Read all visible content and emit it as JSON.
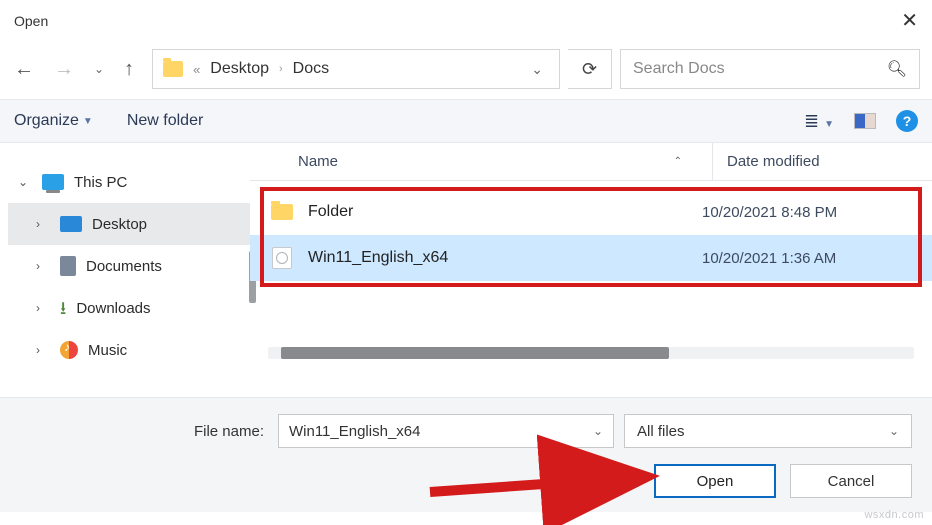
{
  "dialog": {
    "title": "Open"
  },
  "breadcrumb": {
    "root": "Desktop",
    "current": "Docs"
  },
  "search": {
    "placeholder": "Search Docs"
  },
  "toolbar": {
    "organize": "Organize",
    "new_folder": "New folder"
  },
  "sidebar": {
    "root": "This PC",
    "items": [
      {
        "label": "Desktop"
      },
      {
        "label": "Documents"
      },
      {
        "label": "Downloads"
      },
      {
        "label": "Music"
      }
    ]
  },
  "columns": {
    "name": "Name",
    "date": "Date modified"
  },
  "files": [
    {
      "name": "Folder",
      "date": "10/20/2021 8:48 PM"
    },
    {
      "name": "Win11_English_x64",
      "date": "10/20/2021 1:36 AM"
    }
  ],
  "footer": {
    "filename_label": "File name:",
    "filename_value": "Win11_English_x64",
    "filter": "All files",
    "open": "Open",
    "cancel": "Cancel"
  },
  "watermark": "wsxdn.com"
}
